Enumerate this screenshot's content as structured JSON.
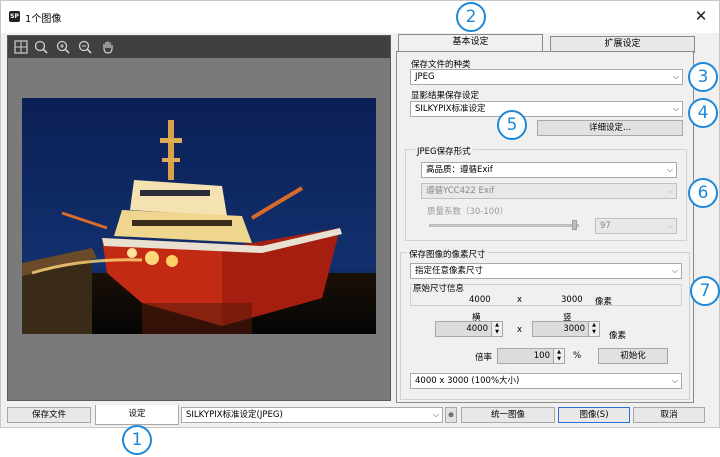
{
  "window": {
    "title": "1个图像",
    "close_glyph": "✕"
  },
  "preview": {
    "toolbar_icons": [
      "fit-grid-icon",
      "zoom-icon",
      "zoom-in-icon",
      "zoom-out-icon",
      "hand-icon"
    ]
  },
  "tabs": {
    "basic": "基本设定",
    "extended": "扩展设定"
  },
  "save_format": {
    "label": "保存文件的种类",
    "value": "JPEG"
  },
  "develop": {
    "label": "显影结果保存设定",
    "value": "SILKYPIX标准设定",
    "detail_button": "详细设定..."
  },
  "jpeg": {
    "group_label": "JPEG保存形式",
    "quality_value": "高品质：遵循Exif",
    "ycc_value": "遵循YCC422 Exif",
    "quality_factor_label": "质量系数（30-100）",
    "quality_factor_value": "97",
    "quality_factor_level": 0.97
  },
  "size": {
    "group_label": "保存图像的像素尺寸",
    "mode_value": "指定任意像素尺寸",
    "original_label": "原始尺寸信息",
    "orig_width": "4000",
    "orig_x": "x",
    "orig_height": "3000",
    "orig_unit": "像素",
    "width_label": "横",
    "height_label": "竖",
    "width_value": "4000",
    "height_value": "3000",
    "times": "x",
    "unit": "像素",
    "ratio_label": "倍率",
    "ratio_value": "100",
    "percent": "%",
    "init_button": "初始化",
    "preset_value": "4000 x 3000 (100%大小)"
  },
  "bottom": {
    "save_file_tab": "保存文件",
    "settings_tab": "设定",
    "preset_value": "SILKYPIX标准设定(JPEG)",
    "unify_button": "统一图像",
    "image_button": "图像(S)",
    "cancel_button": "取消"
  },
  "callouts": [
    "1",
    "2",
    "3",
    "4",
    "5",
    "6",
    "7"
  ],
  "colors": {
    "callout": "#1e88d8",
    "primary_border": "#2a6fd6"
  }
}
